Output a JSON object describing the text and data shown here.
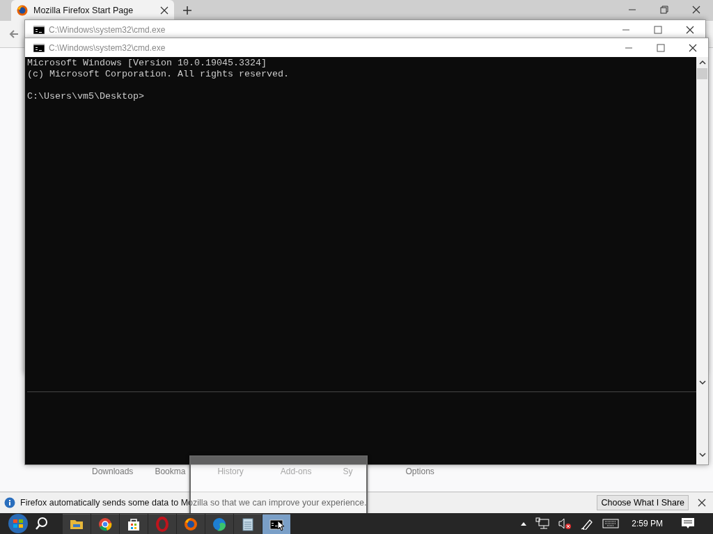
{
  "browser": {
    "tab": {
      "title": "Mozilla Firefox Start Page",
      "selected": true
    },
    "launcher_items": [
      "Downloads",
      "Bookma",
      "History",
      "Add-ons",
      "Sy",
      "Options"
    ],
    "notification": {
      "message": "Firefox automatically sends some data to Mozilla so that we can improve your experience.",
      "button": "Choose What I Share"
    }
  },
  "windows": [
    {
      "title": "C:\\Windows\\system32\\cmd.exe"
    },
    {
      "title": "C:\\Windows\\system32\\cmd.exe",
      "console": [
        [
          "Microsoft Windows [Version 10.0.19045.3324]",
          "(c) Microsoft Corporation. All rights reserved."
        ],
        [
          "C:\\Users\\vm5\\Desktop>"
        ]
      ]
    }
  ],
  "taskbar": {
    "apps": [
      {
        "kind": "explorer",
        "selected": false
      },
      {
        "kind": "chrome",
        "selected": false
      },
      {
        "kind": "store",
        "selected": false
      },
      {
        "kind": "opera",
        "selected": false
      },
      {
        "kind": "firefox",
        "selected": false
      },
      {
        "kind": "edge",
        "selected": false
      },
      {
        "kind": "notepad",
        "selected": false
      },
      {
        "kind": "cmd",
        "selected": true
      }
    ],
    "clock": "2:59 PM"
  }
}
